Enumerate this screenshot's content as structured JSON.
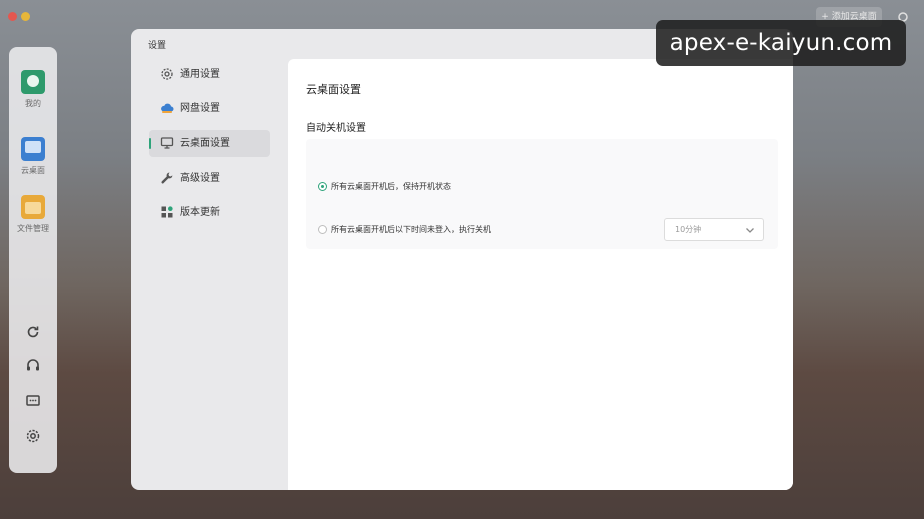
{
  "window": {
    "top_button_label": "+ 添加云桌面"
  },
  "app_sidebar": {
    "items": [
      {
        "label": "我的",
        "icon": "user-icon"
      },
      {
        "label": "云桌面",
        "icon": "monitor-icon"
      },
      {
        "label": "文件管理",
        "icon": "folder-icon"
      }
    ],
    "tools": [
      "refresh-icon",
      "headset-icon",
      "message-icon",
      "gear-icon"
    ]
  },
  "dialog": {
    "title": "设置",
    "menu": [
      {
        "label": "通用设置",
        "icon": "gear-icon"
      },
      {
        "label": "网盘设置",
        "icon": "cloud-icon"
      },
      {
        "label": "云桌面设置",
        "icon": "monitor-icon",
        "active": true
      },
      {
        "label": "高级设置",
        "icon": "wrench-icon"
      },
      {
        "label": "版本更新",
        "icon": "update-icon"
      }
    ]
  },
  "content": {
    "title": "云桌面设置",
    "section_title": "自动关机设置",
    "options": [
      {
        "label": "所有云桌面开机后，保持开机状态",
        "checked": true
      },
      {
        "label": "所有云桌面开机后以下时间未登入，执行关机",
        "checked": false
      }
    ],
    "timeout_select": {
      "value": "10分钟"
    }
  },
  "watermark": "apex-e-kaiyun.com",
  "colors": {
    "accent": "#2ea37a"
  }
}
